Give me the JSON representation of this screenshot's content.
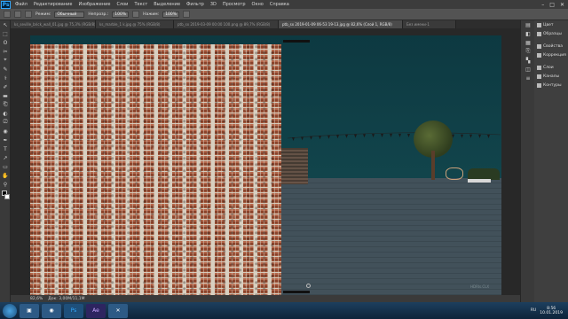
{
  "app": {
    "logo": "Ps"
  },
  "menu": [
    "Файл",
    "Редактирование",
    "Изображение",
    "Слои",
    "Текст",
    "Выделение",
    "Фильтр",
    "3D",
    "Просмотр",
    "Окно",
    "Справка"
  ],
  "window_controls": {
    "minimize": "–",
    "maximize": "□",
    "close": "✕"
  },
  "options": {
    "mode_label": "Режим:",
    "mode_value": "Обычный",
    "opacity_label": "Непрозр.:",
    "opacity_value": "100%",
    "pressure_label": "Нажим:",
    "pressure_value": "100%"
  },
  "tabs": [
    {
      "label": "ks_seville_brick_wall_01.jpg @ 75,3% (RGB/8)",
      "active": false
    },
    {
      "label": "ks_marble_1 k.jpg @ 75% (RGB/8)",
      "active": false
    },
    {
      "label": "ptb_sx 2019-03-09 00:00 100.png @ 89,7% (RGB/8)",
      "active": false
    },
    {
      "label": "ptb_sx 2019-01-09 06-53 19-13.jpg @ 82,6% (Слой 1, RGB/8)",
      "active": true
    },
    {
      "label": "Без имени-1",
      "active": false
    }
  ],
  "tools": [
    "↖",
    "⬚",
    "ʘ",
    "✂",
    "⌖",
    "✎",
    "⚕",
    "✐",
    "▬",
    "⎗",
    "◐",
    "⎚",
    "◉",
    "✒",
    "T",
    "↗",
    "▭",
    "✋",
    "⚲"
  ],
  "canvas": {
    "watermark": "HDRIs.CLX"
  },
  "status": {
    "zoom": "82,6%",
    "doc": "Док: 3,00М/11,1М"
  },
  "panel_strip": [
    "▤",
    "◧",
    "▦",
    "⎘",
    "▚",
    "◫",
    "≡"
  ],
  "panels": [
    {
      "label": "Цвет",
      "icon": "color-icon"
    },
    {
      "label": "Образцы",
      "icon": "swatches-icon"
    },
    {
      "label": "Свойства",
      "icon": "properties-icon"
    },
    {
      "label": "Коррекция",
      "icon": "adjustments-icon"
    },
    {
      "label": "Слои",
      "icon": "layers-icon"
    },
    {
      "label": "Каналы",
      "icon": "channels-icon"
    },
    {
      "label": "Контуры",
      "icon": "paths-icon"
    }
  ],
  "taskbar": {
    "apps": [
      "▣",
      "◉",
      "Ps",
      "Ae",
      "✕"
    ],
    "lang": "RU",
    "time": "8:56",
    "date": "10.01.2019"
  },
  "colors": {
    "foreground": "#000000",
    "background": "#ffffff",
    "accent": "#31a8ff"
  }
}
